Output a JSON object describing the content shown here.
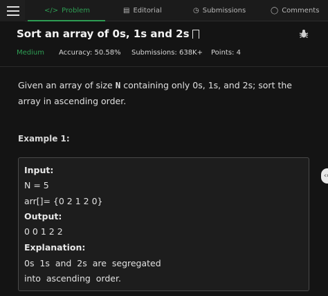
{
  "tabs": [
    {
      "label": "Problem",
      "icon": "</>",
      "active": true
    },
    {
      "label": "Editorial",
      "icon": "▤",
      "active": false
    },
    {
      "label": "Submissions",
      "icon": "◷",
      "active": false
    },
    {
      "label": "Comments",
      "icon": "◯",
      "active": false
    }
  ],
  "problem": {
    "title": "Sort an array of 0s, 1s and 2s",
    "difficulty": "Medium",
    "accuracy": "Accuracy: 50.58%",
    "submissions": "Submissions: 638K+",
    "points": "Points: 4",
    "statement_pre": "Given an array of size ",
    "statement_var": "N",
    "statement_post": " containing only 0s, 1s, and 2s; sort the array in ascending order."
  },
  "example": {
    "heading": "Example 1:",
    "input_label": "Input:",
    "input_line1": "N = 5",
    "input_line2": "arr[]= {0 2 1 2 0}",
    "output_label": "Output:",
    "output_value": "0 0 1 2 2",
    "explanation_label": "Explanation:",
    "explanation_line1": "0s  1s  and  2s  are  segregated",
    "explanation_line2": "into  ascending  order."
  },
  "colors": {
    "accent": "#2e9e54",
    "background": "#141414"
  }
}
